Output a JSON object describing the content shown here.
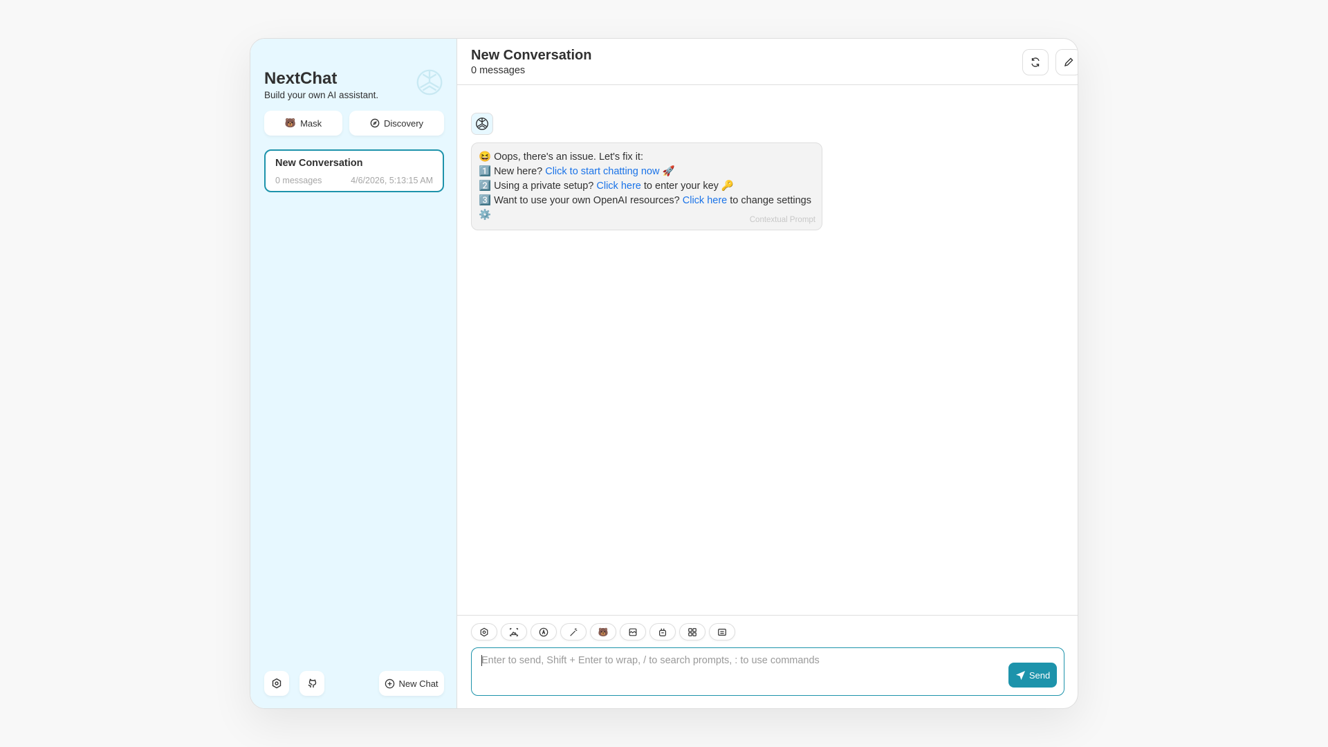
{
  "sidebar": {
    "title": "NextChat",
    "subtitle": "Build your own AI assistant.",
    "mask_label": "Mask",
    "discovery_label": "Discovery",
    "conversations": [
      {
        "title": "New Conversation",
        "count": "0 messages",
        "time": "4/6/2026, 5:13:15 AM"
      }
    ],
    "new_chat_label": "New Chat"
  },
  "header": {
    "title": "New Conversation",
    "subtitle": "0 messages"
  },
  "message": {
    "line0": "😆 Oops, there's an issue. Let's fix it:",
    "l1_pre": "1️⃣ New here? ",
    "l1_link": "Click to start chatting now",
    "l1_post": " 🚀",
    "l2_pre": "2️⃣ Using a private setup? ",
    "l2_link": "Click here",
    "l2_post": " to enter your key 🔑",
    "l3_pre": "3️⃣ Want to use your own OpenAI resources? ",
    "l3_link": "Click here",
    "l3_post": " to change settings ⚙️",
    "context_label": "Contextual Prompt"
  },
  "input": {
    "placeholder": "Enter to send, Shift + Enter to wrap, / to search prompts, : to use commands",
    "send_label": "Send"
  },
  "colors": {
    "accent": "#1d93ab",
    "sidebar_bg": "#e7f8ff",
    "link": "#1a73e8"
  }
}
